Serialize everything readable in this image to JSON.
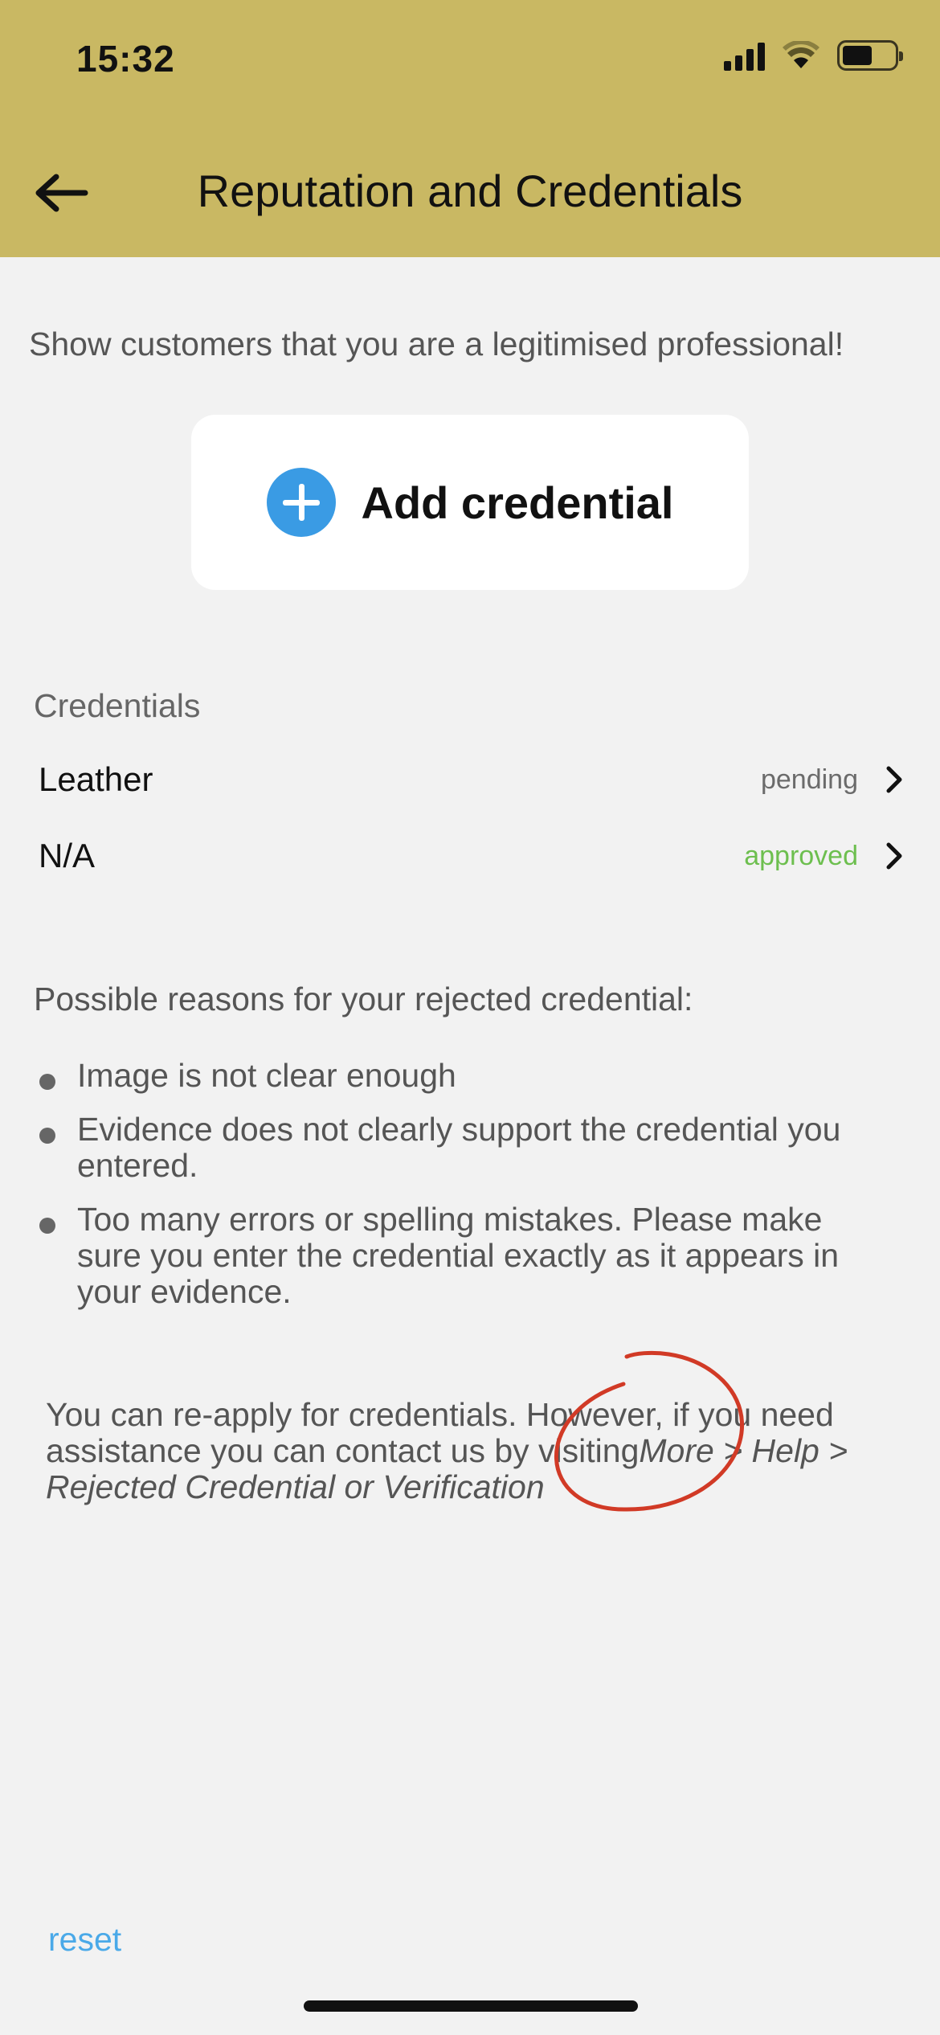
{
  "status_bar": {
    "time": "15:32",
    "colors": {
      "header": "#c9b863"
    }
  },
  "header": {
    "title": "Reputation and Credentials",
    "back_icon": "arrow-left-icon"
  },
  "intro_text": "Show customers that you are a legitimised professional!",
  "add_credential": {
    "label": "Add credential",
    "icon": "plus-circle-icon",
    "icon_color": "#3a9be4"
  },
  "credentials": {
    "section_label": "Credentials",
    "items": [
      {
        "name": "Leather",
        "status": "pending",
        "status_color": "#6b6b6b"
      },
      {
        "name": "N/A",
        "status": "approved",
        "status_color": "#6dbf4f"
      }
    ]
  },
  "rejection": {
    "title": "Possible reasons for your rejected credential:",
    "reasons": [
      "Image is not clear enough",
      "Evidence does not clearly support the credential you entered.",
      "Too many errors or spelling mistakes. Please make sure you enter the credential exactly as it appears in your evidence."
    ]
  },
  "reapply": {
    "text": "You can re-apply for credentials. However, if you need assistance you can contact us by visiting",
    "path": "More > Help > Rejected Credential or Verification"
  },
  "footer": {
    "reset_label": "reset",
    "reset_color": "#4aa9e8"
  }
}
